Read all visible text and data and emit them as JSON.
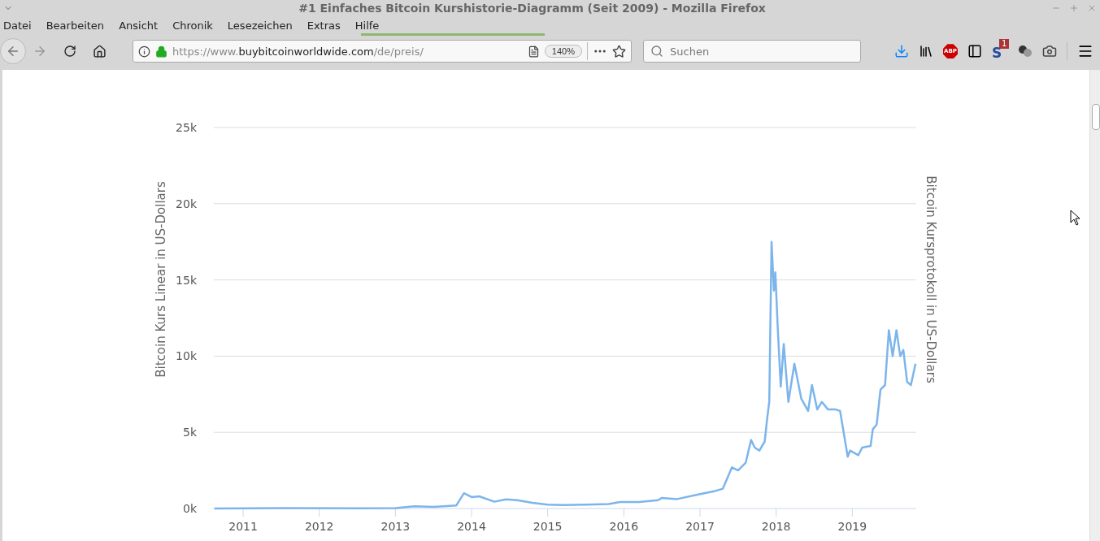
{
  "window": {
    "title": "#1 Einfaches Bitcoin Kurshistorie-Diagramm (Seit 2009) - Mozilla Firefox"
  },
  "menu": [
    "Datei",
    "Bearbeiten",
    "Ansicht",
    "Chronik",
    "Lesezeichen",
    "Extras",
    "Hilfe"
  ],
  "toolbar": {
    "url": {
      "prefix": "https://www.",
      "domain": "buybitcoinworldwide.com",
      "path": "/de/preis/"
    },
    "zoom": "140%",
    "search": {
      "placeholder": "Suchen"
    },
    "adblock_label": "ABP",
    "addon_letter": "S",
    "addon_badge": "1"
  },
  "chart": {
    "right_axis_title": "Bitcoin Kursprotokoll in US-Dollars",
    "chart_data": {
      "type": "line",
      "grid": true,
      "ylabel": "Bitcoin Kurs Linear in US-Dollars",
      "xlim": [
        2010.615,
        2019.84
      ],
      "ylim": [
        0,
        25000
      ],
      "xticks": [
        2011,
        2012,
        2013,
        2014,
        2015,
        2016,
        2017,
        2018,
        2019
      ],
      "yticks": [
        {
          "value": 0,
          "label": "0k"
        },
        {
          "value": 5000,
          "label": "5k"
        },
        {
          "value": 10000,
          "label": "10k"
        },
        {
          "value": 15000,
          "label": "15k"
        },
        {
          "value": 20000,
          "label": "20k"
        },
        {
          "value": 25000,
          "label": "25k"
        }
      ],
      "x": [
        2010.62,
        2011.5,
        2012.5,
        2013.0,
        2013.25,
        2013.5,
        2013.8,
        2013.9,
        2014.0,
        2014.1,
        2014.3,
        2014.45,
        2014.6,
        2014.8,
        2015.0,
        2015.2,
        2015.5,
        2015.8,
        2015.95,
        2016.2,
        2016.45,
        2016.5,
        2016.7,
        2017.0,
        2017.2,
        2017.3,
        2017.42,
        2017.5,
        2017.6,
        2017.67,
        2017.72,
        2017.78,
        2017.85,
        2017.88,
        2017.91,
        2017.94,
        2017.97,
        2017.99,
        2018.02,
        2018.06,
        2018.1,
        2018.16,
        2018.24,
        2018.33,
        2018.42,
        2018.47,
        2018.54,
        2018.6,
        2018.68,
        2018.78,
        2018.84,
        2018.94,
        2018.97,
        2019.08,
        2019.13,
        2019.24,
        2019.27,
        2019.32,
        2019.37,
        2019.43,
        2019.48,
        2019.53,
        2019.58,
        2019.63,
        2019.67,
        2019.72,
        2019.77,
        2019.83
      ],
      "series": [
        {
          "color": "#7cb5ec",
          "values": [
            0,
            30,
            10,
            20,
            150,
            100,
            200,
            1000,
            750,
            800,
            450,
            600,
            550,
            380,
            250,
            230,
            250,
            300,
            420,
            420,
            550,
            700,
            620,
            950,
            1150,
            1300,
            2700,
            2500,
            3000,
            4500,
            4000,
            3800,
            4400,
            5800,
            7000,
            17500,
            14300,
            15500,
            12000,
            8000,
            10800,
            7000,
            9500,
            7200,
            6400,
            8100,
            6500,
            7000,
            6500,
            6500,
            6400,
            3400,
            3800,
            3500,
            4000,
            4100,
            5200,
            5500,
            7800,
            8100,
            11700,
            10000,
            11700,
            10000,
            10400,
            8300,
            8100,
            9500
          ]
        }
      ]
    }
  }
}
